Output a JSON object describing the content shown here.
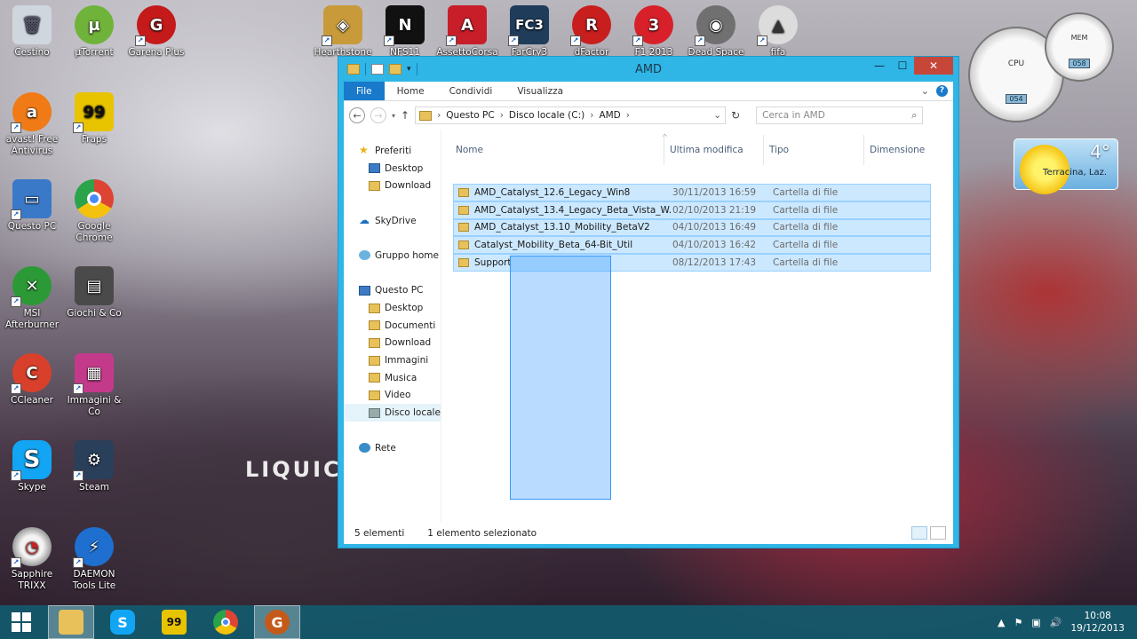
{
  "desktop": {
    "left_icons": [
      {
        "label": "Cestino",
        "icon": "recycle-bin-icon",
        "color": "#d0d6de"
      },
      {
        "label": "µTorrent",
        "icon": "utorrent-icon",
        "color": "#6fb33a"
      },
      {
        "label": "Garena Plus",
        "icon": "garena-icon",
        "color": "#c41a1a"
      },
      {
        "label": "avast! Free Antivirus",
        "icon": "avast-icon",
        "color": "#f07a15"
      },
      {
        "label": "Fraps",
        "icon": "fraps-icon",
        "color": "#e8c400"
      },
      {
        "label": "Questo PC",
        "icon": "computer-icon",
        "color": "#3a78c8"
      },
      {
        "label": "Google Chrome",
        "icon": "chrome-icon",
        "color": "#dd4433"
      },
      {
        "label": "MSI Afterburner",
        "icon": "msi-afterburner-icon",
        "color": "#2b9a36"
      },
      {
        "label": "Giochi & Co",
        "icon": "games-folder-icon",
        "color": "#4a4a4a"
      },
      {
        "label": "CCleaner",
        "icon": "ccleaner-icon",
        "color": "#d8402c"
      },
      {
        "label": "Immagini & Co",
        "icon": "images-folder-icon",
        "color": "#c43a8a"
      },
      {
        "label": "Skype",
        "icon": "skype-icon",
        "color": "#12a5f4"
      },
      {
        "label": "Steam",
        "icon": "steam-icon",
        "color": "#2a3f5a"
      },
      {
        "label": "Sapphire TRIXX",
        "icon": "trixx-icon",
        "color": "#9a9a9a"
      },
      {
        "label": "DAEMON Tools Lite",
        "icon": "daemon-tools-icon",
        "color": "#1e6fd0"
      }
    ],
    "top_icons": [
      {
        "label": "Hearthstone",
        "icon": "hearthstone-icon",
        "color": "#c89a3a"
      },
      {
        "label": "NFS11",
        "icon": "nfs-icon",
        "color": "#111111"
      },
      {
        "label": "AssettoCorsa",
        "icon": "assetto-corsa-icon",
        "color": "#c81e2a"
      },
      {
        "label": "FarCry3",
        "icon": "farcry3-icon",
        "color": "#1f3c5a"
      },
      {
        "label": "dFactor",
        "icon": "rfactor-icon",
        "color": "#c81e1e"
      },
      {
        "label": "F1 2013 Launcher",
        "icon": "f1-icon",
        "color": "#d8202a"
      },
      {
        "label": "Dead Space",
        "icon": "dead-space-icon",
        "color": "#707070"
      },
      {
        "label": "fifa",
        "icon": "fifa-icon",
        "color": "#dcdcdc"
      }
    ],
    "watermark": "LIQUICI"
  },
  "explorer": {
    "title": "AMD",
    "ribbon_tabs": [
      "File",
      "Home",
      "Condividi",
      "Visualizza"
    ],
    "breadcrumb": [
      "Questo PC",
      "Disco locale (C:)",
      "AMD"
    ],
    "search_placeholder": "Cerca in AMD",
    "nav": {
      "favorites": "Preferiti",
      "fav_items": [
        "Desktop",
        "Download"
      ],
      "skydrive": "SkyDrive",
      "homegroup": "Gruppo home",
      "this_pc": "Questo PC",
      "pc_items": [
        "Desktop",
        "Documenti",
        "Download",
        "Immagini",
        "Musica",
        "Video",
        "Disco locale"
      ],
      "network": "Rete"
    },
    "columns": {
      "name": "Nome",
      "modified": "Ultima modifica",
      "type": "Tipo",
      "size": "Dimensione"
    },
    "files": [
      {
        "name": "AMD_Catalyst_12.6_Legacy_Win8",
        "modified": "30/11/2013 16:59",
        "type": "Cartella di file"
      },
      {
        "name": "AMD_Catalyst_13.4_Legacy_Beta_Vista_W...",
        "modified": "02/10/2013 21:19",
        "type": "Cartella di file"
      },
      {
        "name": "AMD_Catalyst_13.10_Mobility_BetaV2",
        "modified": "04/10/2013 16:49",
        "type": "Cartella di file"
      },
      {
        "name": "Catalyst_Mobility_Beta_64-Bit_Util",
        "modified": "04/10/2013 16:42",
        "type": "Cartella di file"
      },
      {
        "name": "Support",
        "modified": "08/12/2013 17:43",
        "type": "Cartella di file"
      }
    ],
    "status_count": "5 elementi",
    "status_selected": "1 elemento selezionato"
  },
  "gadgets": {
    "cpu_label": "CPU",
    "cpu_value": "054",
    "mem_label": "MEM",
    "mem_value": "058",
    "weather_temp": "4°",
    "weather_city": "Terracina, Laz."
  },
  "taskbar": {
    "time": "10:08",
    "date": "19/12/2013"
  },
  "colors": {
    "window_border": "#2fb5e6",
    "selection": "#cce8ff",
    "file_tab": "#1979ca",
    "close_button": "#c7463a"
  }
}
